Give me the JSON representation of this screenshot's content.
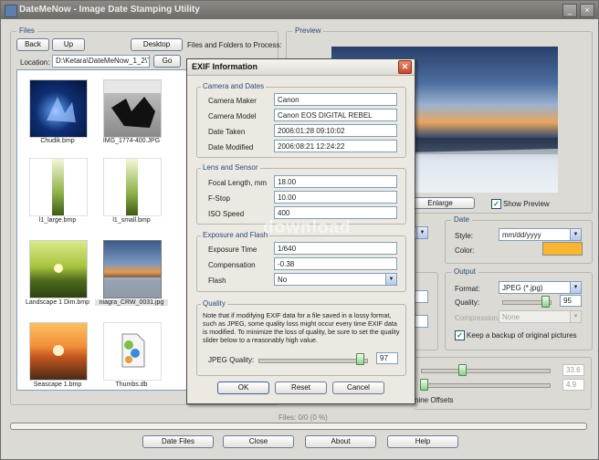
{
  "window": {
    "title": "DateMeNow - Image Date Stamping Utility",
    "min": "_",
    "close": "×"
  },
  "files": {
    "group_label": "Files",
    "back": "Back",
    "up": "Up",
    "desktop": "Desktop",
    "hint": "Files and Folders to Process:",
    "location_label": "Location:",
    "location_value": "D:\\Ketara\\DateMeNow_1_2\\T",
    "go": "Go",
    "items": [
      {
        "name": "Chudik.bmp",
        "icon": "image-icon"
      },
      {
        "name": "IMG_1774-400.JPG",
        "icon": "image-icon"
      },
      {
        "name": "l1_large.bmp",
        "icon": "image-icon"
      },
      {
        "name": "l1_small.bmp",
        "icon": "image-icon"
      },
      {
        "name": "Landscape 1 Dim.bmp",
        "icon": "image-icon"
      },
      {
        "name": "niagra_CRW_0031.jpg",
        "icon": "image-icon"
      },
      {
        "name": "Seascape 1.bmp",
        "icon": "image-icon"
      },
      {
        "name": "Thumbs.db",
        "icon": "db-file-icon"
      }
    ]
  },
  "preview": {
    "group_label": "Preview",
    "enlarge": "Enlarge",
    "show_preview": "Show Preview",
    "show_preview_checked": true
  },
  "date": {
    "group_label": "Date",
    "style_label": "Style:",
    "style_value": "mm/dd/yyyy",
    "color_label": "Color:",
    "color_value": "#f7b733"
  },
  "output": {
    "group_label": "Output",
    "format_label": "Format:",
    "format_value": "JPEG (*.jpg)",
    "quality_label": "Quality:",
    "quality_value": "95",
    "quality_level": 0.95,
    "compression_label": "Compression:",
    "compression_value": "None",
    "backup_label": "Keep a backup of original pictures",
    "backup_checked": true
  },
  "offsets": {
    "value1": "33.6",
    "value2": "4.9",
    "label_fragment": "nine Offsets"
  },
  "status": {
    "files": "Files: 0/0 (0 %)"
  },
  "bottom_buttons": {
    "date_files": "Date Files",
    "close": "Close",
    "about": "About",
    "help": "Help"
  },
  "watermark": "download",
  "exif": {
    "title": "EXIF Information",
    "camera": {
      "group_label": "Camera and Dates",
      "maker_label": "Camera Maker",
      "maker_value": "Canon",
      "model_label": "Camera Model",
      "model_value": "Canon EOS DIGITAL REBEL",
      "taken_label": "Date Taken",
      "taken_value": "2006:01:28 09:10:02",
      "modified_label": "Date Modified",
      "modified_value": "2006:08:21 12:24:22"
    },
    "lens": {
      "group_label": "Lens and Sensor",
      "focal_label": "Focal Length, mm",
      "focal_value": "18.00",
      "fstop_label": "F-Stop",
      "fstop_value": "10.00",
      "iso_label": "ISO Speed",
      "iso_value": "400"
    },
    "exposure": {
      "group_label": "Exposure and Flash",
      "time_label": "Exposure Time",
      "time_value": "1/640",
      "comp_label": "Compensation",
      "comp_value": "-0.38",
      "flash_label": "Flash",
      "flash_value": "No"
    },
    "quality": {
      "group_label": "Quality",
      "note": "Note that if modifying EXIF data for a file saved in a lossy format, such as JPEG, some quality loss might occur every time EXIF data is modified. To minimize the loss of quality, be sure to set the quality slider below to a reasonably high value.",
      "jpeg_label": "JPEG Quality:",
      "jpeg_value": "97",
      "jpeg_level": 0.97
    },
    "ok": "OK",
    "reset": "Reset",
    "cancel": "Cancel"
  }
}
